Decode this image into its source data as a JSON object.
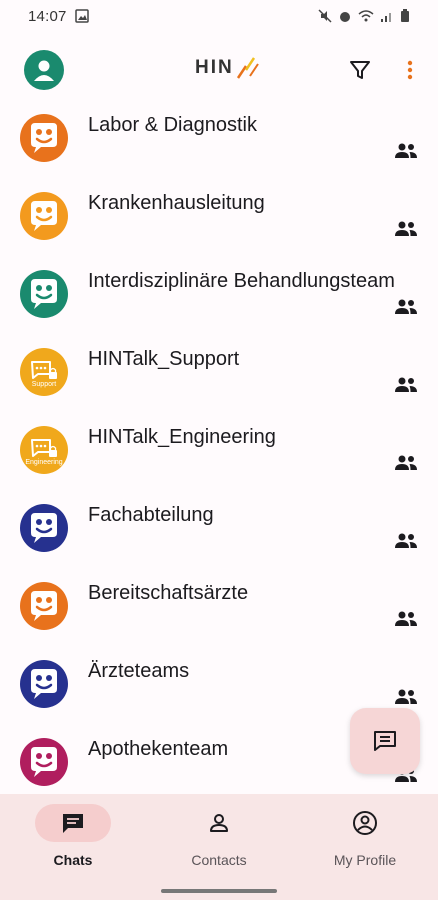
{
  "status_bar": {
    "time": "14:07"
  },
  "app": {
    "logo_text": "HIN"
  },
  "chats": [
    {
      "name": "Labor & Diagnostik",
      "color": "#e8721c",
      "kind": "group"
    },
    {
      "name": "Krankenhausleitung",
      "color": "#f39a1e",
      "kind": "group"
    },
    {
      "name": "Interdisziplinäre Behandlungsteam",
      "color": "#1a8a6e",
      "kind": "group"
    },
    {
      "name": "HINTalk_Support",
      "color": "#f0a81c",
      "kind": "bot",
      "badge": "Support"
    },
    {
      "name": "HINTalk_Engineering",
      "color": "#f0a81c",
      "kind": "bot",
      "badge": "Engineering"
    },
    {
      "name": "Fachabteilung",
      "color": "#26318f",
      "kind": "group"
    },
    {
      "name": "Bereitschaftsärzte",
      "color": "#e8721c",
      "kind": "group"
    },
    {
      "name": "Ärzteteams",
      "color": "#26318f",
      "kind": "group"
    },
    {
      "name": "Apothekenteam",
      "color": "#b01e5e",
      "kind": "group"
    }
  ],
  "nav": {
    "chats": "Chats",
    "contacts": "Contacts",
    "profile": "My Profile"
  },
  "colors": {
    "accent": "#e8721c",
    "nav_bg": "#f8e6e6",
    "fab_bg": "#f6d6d6"
  }
}
